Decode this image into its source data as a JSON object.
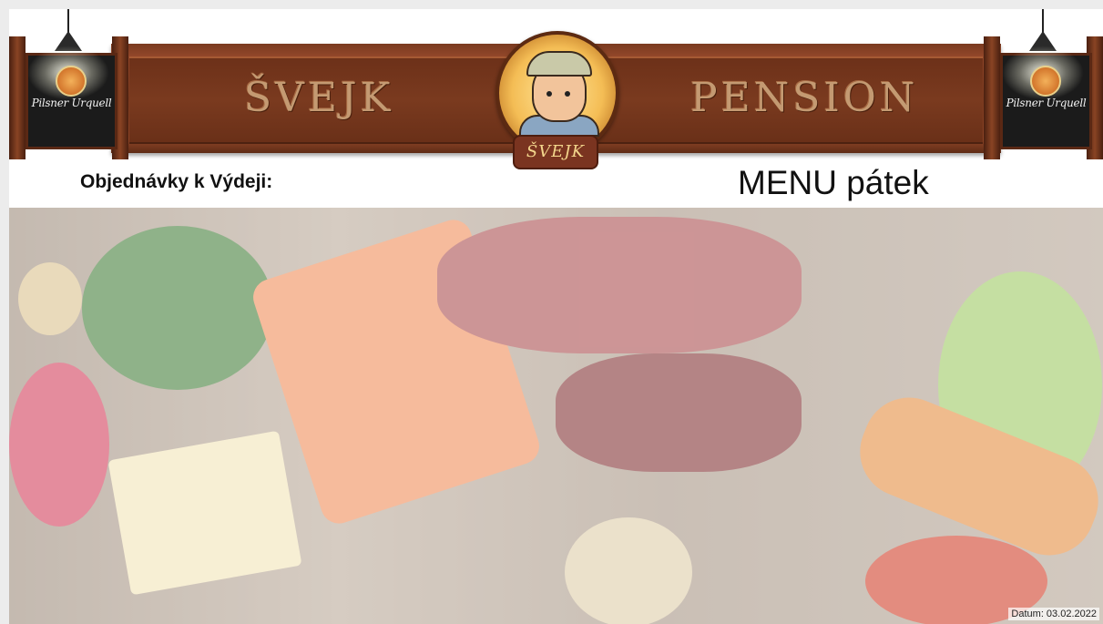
{
  "banner": {
    "left_word": "ŠVEJK",
    "right_word": "PENSION",
    "medallion_label": "ŠVEJK",
    "brand_left": "Pilsner Urquell",
    "brand_right": "Pilsner Urquell"
  },
  "orders_title": "Objednávky k Výdeji:",
  "menu_title": "MENU pátek",
  "background_image": "food-ingredients-photo",
  "date_text": "Datum: 03.02.2022",
  "colors": {
    "wood": "#7a3a1f",
    "banner_text": "#c49a72",
    "medallion_gold": "#f4bd55"
  }
}
